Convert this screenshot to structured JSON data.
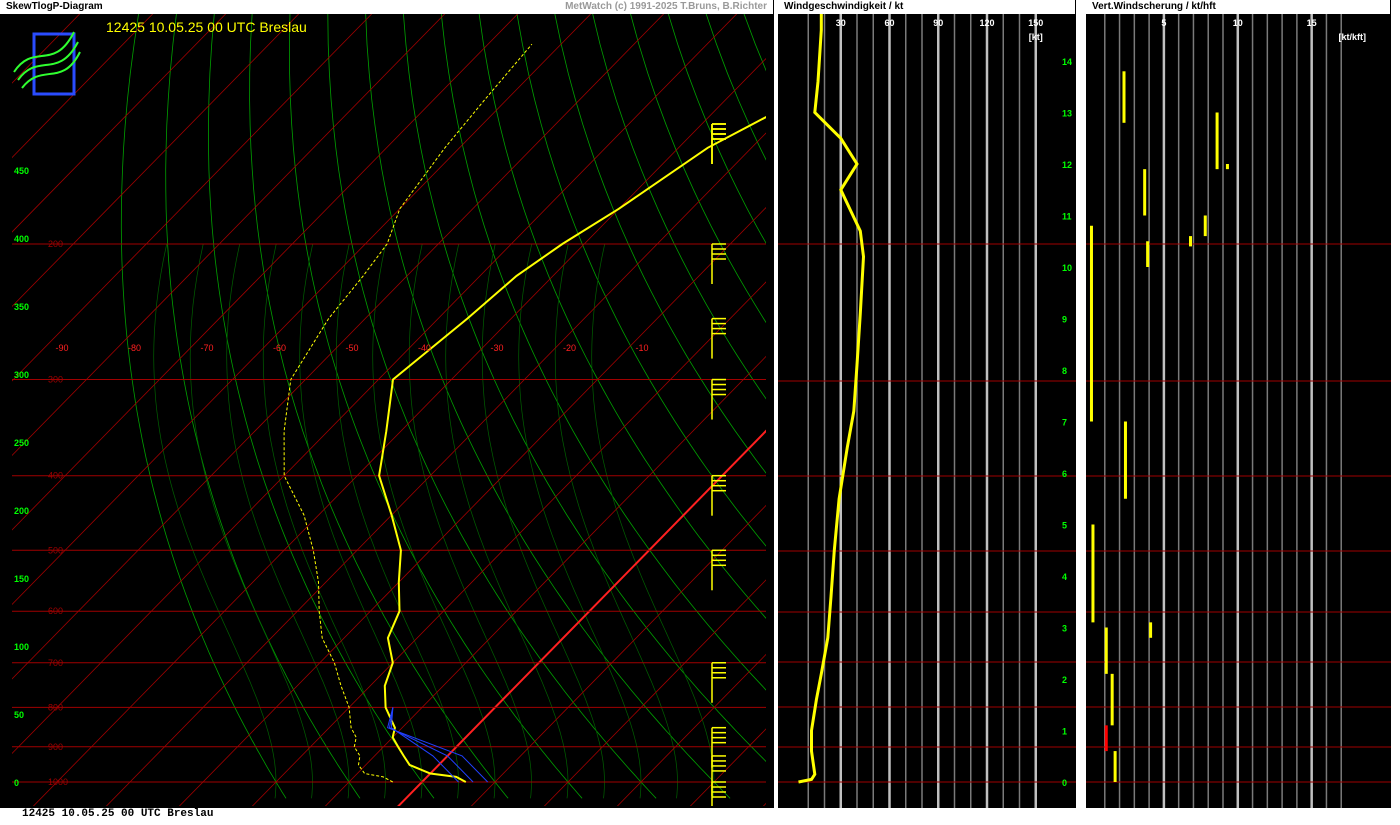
{
  "panels": {
    "skewt": {
      "header": "SkewTlogP-Diagram",
      "credit": "MetWatch  (c) 1991-2025 T.Bruns, B.Richter",
      "title": "12425 10.05.25 00 UTC Breslau"
    },
    "wind": {
      "header": "Windgeschwindigkeit / kt"
    },
    "shear": {
      "header": "Vert.Windscherung / kt/hft"
    }
  },
  "footer": "12425 10.05.25 00 UTC Breslau",
  "chart_data": [
    {
      "type": "line",
      "name": "skewt",
      "title": "12425 10.05.25 00 UTC Breslau",
      "temperature_labels": [
        "-90",
        "-80",
        "-70",
        "-60",
        "-50",
        "-40",
        "-30",
        "-20",
        "-10"
      ],
      "temperature_values": [
        -90,
        -80,
        -70,
        -60,
        -50,
        -40,
        -30,
        -20,
        -10
      ],
      "pressure_labels": [
        "1000",
        "900",
        "800",
        "700",
        "600",
        "500",
        "400",
        "300",
        "200"
      ],
      "pressure_values": [
        1000,
        900,
        800,
        700,
        600,
        500,
        400,
        300,
        200
      ],
      "height_hft_labels": [
        "0",
        "50",
        "100",
        "150",
        "200",
        "250",
        "300",
        "350",
        "400",
        "450"
      ],
      "height_hft_values": [
        0,
        50,
        100,
        150,
        200,
        250,
        300,
        350,
        400,
        450
      ],
      "series": [
        {
          "key": "temperature",
          "points": [
            [
              1000,
              6
            ],
            [
              985,
              4
            ],
            [
              975,
              0
            ],
            [
              950,
              -4
            ],
            [
              925,
              -6
            ],
            [
              900,
              -8
            ],
            [
              875,
              -10
            ],
            [
              850,
              -11
            ],
            [
              800,
              -15
            ],
            [
              750,
              -18
            ],
            [
              700,
              -20
            ],
            [
              650,
              -24
            ],
            [
              600,
              -26
            ],
            [
              550,
              -30
            ],
            [
              500,
              -34
            ],
            [
              450,
              -40
            ],
            [
              400,
              -47
            ],
            [
              350,
              -52
            ],
            [
              300,
              -58
            ],
            [
              250,
              -56
            ],
            [
              220,
              -55
            ],
            [
              200,
              -53
            ],
            [
              180,
              -50
            ],
            [
              150,
              -46
            ],
            [
              130,
              -40
            ],
            [
              110,
              -34
            ]
          ],
          "color": "#ffff00"
        },
        {
          "key": "dewpoint",
          "points": [
            [
              1000,
              -4
            ],
            [
              985,
              -6
            ],
            [
              975,
              -9
            ],
            [
              950,
              -11
            ],
            [
              925,
              -12
            ],
            [
              900,
              -14
            ],
            [
              875,
              -15
            ],
            [
              850,
              -17
            ],
            [
              800,
              -20
            ],
            [
              750,
              -24
            ],
            [
              700,
              -28
            ],
            [
              650,
              -33
            ],
            [
              600,
              -37
            ],
            [
              550,
              -41
            ],
            [
              500,
              -46
            ],
            [
              450,
              -52
            ],
            [
              400,
              -60
            ],
            [
              350,
              -66
            ],
            [
              300,
              -72
            ],
            [
              250,
              -75
            ],
            [
              220,
              -76
            ],
            [
              200,
              -77
            ],
            [
              180,
              -80
            ],
            [
              150,
              -82
            ],
            [
              130,
              -83
            ],
            [
              110,
              -84
            ]
          ],
          "color": "#ffff00",
          "dashed": true
        },
        {
          "key": "freezing",
          "isotherm": 0,
          "color": "#ff0000"
        }
      ],
      "wind_barbs_pressure": [
        1000,
        925,
        850,
        700,
        500,
        400,
        300,
        250,
        200,
        150,
        125,
        100
      ]
    },
    {
      "type": "line",
      "name": "wind-speed",
      "xlabel": "Windgeschwindigkeit / kt",
      "unit_label": "[kt]",
      "x_tick_labels": [
        "30",
        "60",
        "90",
        "120",
        "150"
      ],
      "x_ticks": [
        30,
        60,
        90,
        120,
        150
      ],
      "xlim": [
        0,
        160
      ],
      "height_km_labels": [
        "0",
        "1",
        "2",
        "3",
        "4",
        "5",
        "6",
        "7",
        "8",
        "9",
        "10",
        "11",
        "12",
        "13",
        "14",
        "15",
        "16"
      ],
      "height_km_values": [
        0,
        1,
        2,
        3,
        4,
        5,
        6,
        7,
        8,
        9,
        10,
        11,
        12,
        13,
        14,
        15,
        16
      ],
      "series": [
        {
          "key": "speed",
          "points": [
            [
              0,
              4
            ],
            [
              0.05,
              12
            ],
            [
              0.15,
              14
            ],
            [
              0.6,
              12
            ],
            [
              1.0,
              12
            ],
            [
              1.6,
              15
            ],
            [
              2.1,
              18
            ],
            [
              2.8,
              22
            ],
            [
              3.6,
              24
            ],
            [
              4.5,
              26
            ],
            [
              5.5,
              29
            ],
            [
              6.5,
              34
            ],
            [
              7.2,
              38
            ],
            [
              8.1,
              40
            ],
            [
              9.1,
              42
            ],
            [
              10.2,
              44
            ],
            [
              10.7,
              42
            ],
            [
              11.1,
              36
            ],
            [
              11.5,
              30
            ],
            [
              12.0,
              40
            ],
            [
              12.5,
              30
            ],
            [
              13.0,
              14
            ],
            [
              13.6,
              16
            ],
            [
              14.6,
              18
            ],
            [
              15.6,
              18
            ],
            [
              16.3,
              18
            ]
          ],
          "color": "#ffff00"
        }
      ]
    },
    {
      "type": "bar",
      "name": "vertical-wind-shear",
      "xlabel": "Vert.Windscherung / kt/hft",
      "unit_label": "[kt/kft]",
      "x_tick_labels": [
        "5",
        "10",
        "15"
      ],
      "x_ticks": [
        5,
        10,
        15
      ],
      "xlim": [
        0,
        18
      ],
      "segments": [
        {
          "z0": 0.0,
          "z1": 0.6,
          "v": 1.7,
          "color": "#ffff00"
        },
        {
          "z0": 0.6,
          "z1": 1.1,
          "v": 1.1,
          "color": "#ff0000"
        },
        {
          "z0": 1.1,
          "z1": 2.1,
          "v": 1.5,
          "color": "#ffff00"
        },
        {
          "z0": 2.1,
          "z1": 3.0,
          "v": 1.1,
          "color": "#ffff00"
        },
        {
          "z0": 2.8,
          "z1": 3.1,
          "v": 4.1,
          "color": "#ffff00"
        },
        {
          "z0": 3.1,
          "z1": 5.0,
          "v": 0.2,
          "color": "#ffff00"
        },
        {
          "z0": 5.5,
          "z1": 7.0,
          "v": 2.4,
          "color": "#ffff00"
        },
        {
          "z0": 7.0,
          "z1": 10.8,
          "v": 0.1,
          "color": "#ffff00"
        },
        {
          "z0": 10.0,
          "z1": 10.5,
          "v": 3.9,
          "color": "#ffff00"
        },
        {
          "z0": 10.4,
          "z1": 10.6,
          "v": 6.8,
          "color": "#ffff00"
        },
        {
          "z0": 10.6,
          "z1": 11.0,
          "v": 7.8,
          "color": "#ffff00"
        },
        {
          "z0": 11.0,
          "z1": 11.9,
          "v": 3.7,
          "color": "#ffff00"
        },
        {
          "z0": 11.9,
          "z1": 12.0,
          "v": 9.3,
          "color": "#ffff00"
        },
        {
          "z0": 11.9,
          "z1": 13.0,
          "v": 8.6,
          "color": "#ffff00"
        },
        {
          "z0": 12.8,
          "z1": 13.8,
          "v": 2.3,
          "color": "#ffff00"
        }
      ]
    }
  ]
}
